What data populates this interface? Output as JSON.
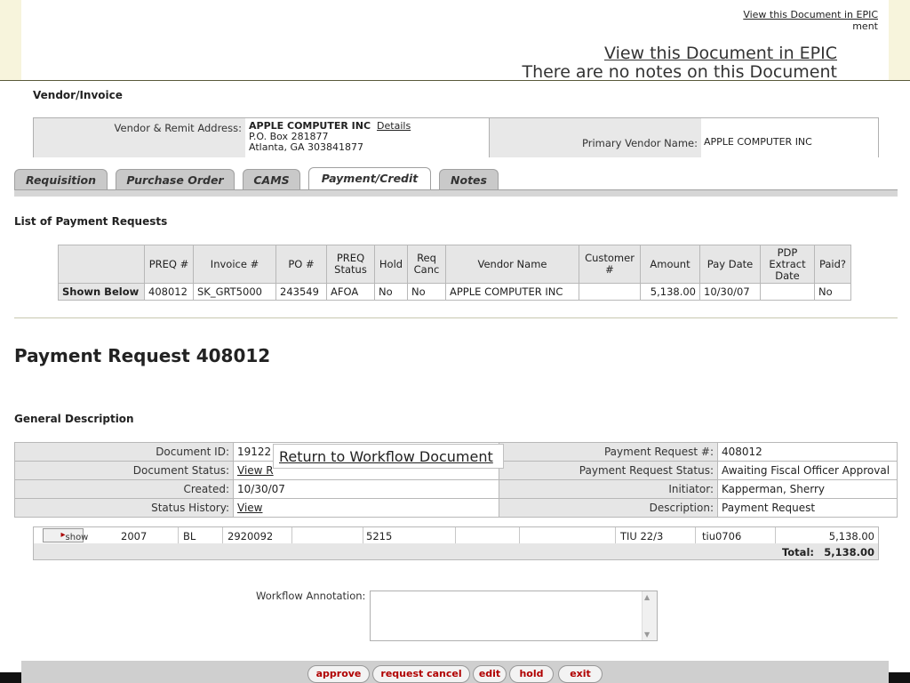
{
  "header": {
    "epic_small_link": "View this Document in EPIC",
    "epic_small_sub": "ment",
    "epic_big_link": "View this Document in EPIC",
    "notes_text": "There are no notes on this Document"
  },
  "vendor": {
    "section_title": "Vendor/Invoice",
    "remit_label": "Vendor & Remit Address:",
    "name": "APPLE COMPUTER INC",
    "details_link": "Details",
    "addr1": "P.O. Box 281877",
    "addr2": "Atlanta,  GA  303841877",
    "primary_label": "Primary Vendor Name:",
    "primary_value": "APPLE COMPUTER INC"
  },
  "tabs": [
    "Requisition",
    "Purchase Order",
    "CAMS",
    "Payment/Credit",
    "Notes"
  ],
  "payment_requests": {
    "title": "List of Payment Requests",
    "headers": [
      "PREQ #",
      "Invoice #",
      "PO #",
      "PREQ Status",
      "Hold",
      "Req Canc",
      "Vendor Name",
      "Customer #",
      "Amount",
      "Pay Date",
      "PDP Extract Date",
      "Paid?"
    ],
    "row": {
      "label": "Shown Below",
      "cells": [
        "408012",
        "SK_GRT5000",
        "243549",
        "AFOA",
        "No",
        "No",
        "APPLE COMPUTER INC",
        "",
        "5,138.00",
        "10/30/07",
        "",
        "No"
      ]
    }
  },
  "page_title": "Payment Request 408012",
  "general": {
    "title": "General Description",
    "doc_id_label": "Document ID:",
    "doc_id_value": "19122",
    "doc_status_label": "Document Status:",
    "doc_status_value": "View R",
    "created_label": "Created:",
    "created_value": "10/30/07",
    "status_history_label": "Status History:",
    "status_history_value": "View",
    "preq_no_label": "Payment Request #:",
    "preq_no_value": "408012",
    "preq_status_label": "Payment Request Status:",
    "preq_status_value": "Awaiting Fiscal Officer Approval",
    "initiator_label": "Initiator:",
    "initiator_value": "Kapperman, Sherry",
    "description_label": "Description:",
    "description_value": "Payment Request",
    "tooltip": "Return to Workflow Document"
  },
  "accounting": {
    "show_label": "show",
    "cells": [
      "2007",
      "BL",
      "2920092",
      "5215",
      "TIU 22/3",
      "tiu0706",
      "5,138.00"
    ],
    "total_label": "Total:",
    "total_value": "5,138.00"
  },
  "workflow_label": "Workflow Annotation:",
  "buttons": [
    "approve",
    "request cancel",
    "edit",
    "hold",
    "exit"
  ]
}
